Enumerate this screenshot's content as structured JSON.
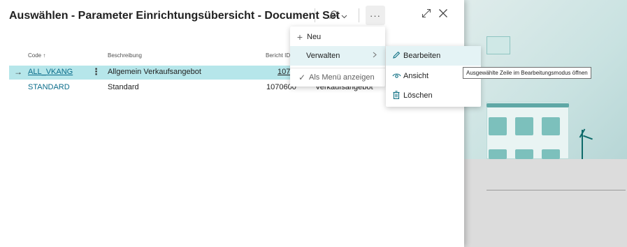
{
  "dialog": {
    "title": "Auswählen - Parameter Einrichtungsübersicht - Document Set",
    "more_label": "···"
  },
  "icons": {
    "search": "search-icon",
    "chevron": "chevron-down-icon",
    "expand": "expand-icon",
    "close": "close-icon"
  },
  "table": {
    "headers": [
      "Code ↑",
      "Beschreibung",
      "Bericht ID"
    ],
    "rows": [
      {
        "code": "ALL_VKANG",
        "description": "Allgemein Verkaufsangebot",
        "report_id": "1070",
        "extra": ""
      },
      {
        "code": "STANDARD",
        "description": "Standard",
        "report_id": "1070600",
        "extra": "Verkaufsangebot"
      }
    ]
  },
  "menu_main": {
    "new": "Neu",
    "manage": "Verwalten",
    "show_as_menu": "Als Menü anzeigen"
  },
  "menu_sub": {
    "edit": "Bearbeiten",
    "view": "Ansicht",
    "delete": "Löschen"
  },
  "tooltip": "Ausgewählte Zeile im Bearbeitungsmodus öffnen",
  "colors": {
    "selected_row": "#b6e6ea",
    "accent": "#0e6f83",
    "link": "#0a6c8a"
  }
}
